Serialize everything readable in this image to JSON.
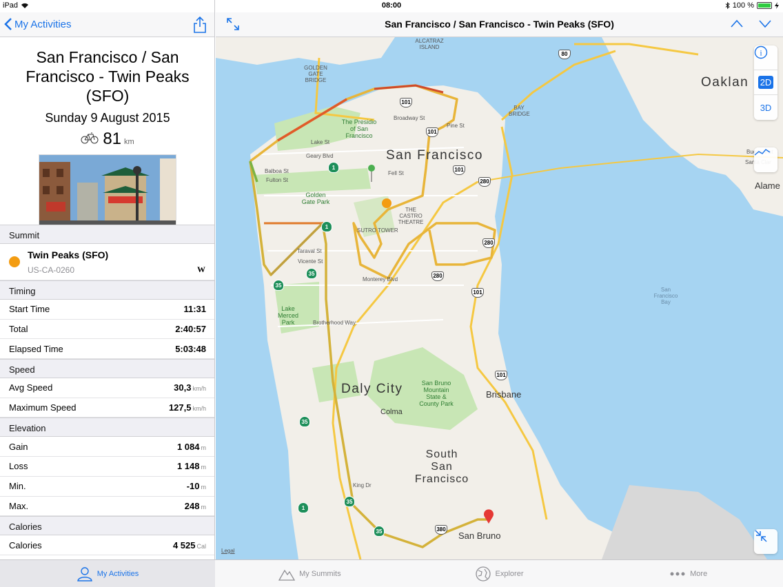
{
  "status_bar": {
    "device": "iPad",
    "time": "08:00",
    "battery": "100 %"
  },
  "left_nav": {
    "back_label": "My Activities"
  },
  "activity": {
    "title": "San Francisco / San Francisco - Twin Peaks (SFO)",
    "date": "Sunday 9 August 2015",
    "distance": "81",
    "distance_unit": "km"
  },
  "sections": {
    "summit": {
      "header": "Summit",
      "name": "Twin Peaks (SFO)",
      "code": "US-CA-0260",
      "wiki": "W"
    },
    "timing": {
      "header": "Timing",
      "rows": [
        {
          "label": "Start Time",
          "value": "11:31",
          "unit": ""
        },
        {
          "label": "Total",
          "value": "2:40:57",
          "unit": ""
        },
        {
          "label": "Elapsed Time",
          "value": "5:03:48",
          "unit": ""
        }
      ]
    },
    "speed": {
      "header": "Speed",
      "rows": [
        {
          "label": "Avg Speed",
          "value": "30,3",
          "unit": "km/h"
        },
        {
          "label": "Maximum Speed",
          "value": "127,5",
          "unit": "km/h"
        }
      ]
    },
    "elevation": {
      "header": "Elevation",
      "rows": [
        {
          "label": "Gain",
          "value": "1 084",
          "unit": "m"
        },
        {
          "label": "Loss",
          "value": "1 148",
          "unit": "m"
        },
        {
          "label": "Min.",
          "value": "-10",
          "unit": "m"
        },
        {
          "label": "Max.",
          "value": "248",
          "unit": "m"
        }
      ]
    },
    "calories": {
      "header": "Calories",
      "rows": [
        {
          "label": "Calories",
          "value": "4 525",
          "unit": "Cal"
        }
      ]
    }
  },
  "map_nav": {
    "title": "San Francisco / San Francisco - Twin Peaks (SFO)"
  },
  "map": {
    "labels": {
      "sf": "San Francisco",
      "daly": "Daly City",
      "ssf": "South San Francisco",
      "brisbane": "Brisbane",
      "colma": "Colma",
      "sanbruno": "San Bruno",
      "oakland": "Oaklan",
      "alameda": "Alame",
      "presidio": "The Presidio of San Francisco",
      "ggpark": "Golden Gate Park",
      "lakemerced": "Lake Merced Park",
      "sanbrunopark": "San Bruno Mountain State & County Park",
      "sutro": "SUTRO TOWER",
      "castro": "THE CASTRO THEATRE",
      "ggbridge": "GOLDEN GATE BRIDGE",
      "baybridge": "BAY BRIDGE",
      "alcatraz": "ALCATRAZ ISLAND",
      "sfbay": "San Francisco Bay",
      "lake_st": "Lake St",
      "geary": "Geary Blvd",
      "balboa": "Balboa St",
      "fulton": "Fulton St",
      "fell": "Fell St",
      "broadway": "Broadway St",
      "pine": "Pine St",
      "taraval": "Taraval St",
      "vicente": "Vicente St",
      "monterey": "Monterey Blvd",
      "brotherhood": "Brotherhood Way",
      "king": "King Dr",
      "buenavista": "Buena Vist",
      "santaclara": "Santa Clar"
    },
    "shields": [
      "80",
      "101",
      "101",
      "101",
      "280",
      "280",
      "280",
      "101",
      "101",
      "1",
      "1",
      "35",
      "35",
      "35",
      "35",
      "35",
      "1",
      "380"
    ],
    "controls": {
      "info": "i",
      "mode2d": "2D",
      "mode3d": "3D"
    },
    "legal": "Legal"
  },
  "tabs": [
    {
      "label": "My Activities",
      "icon": "person-icon"
    },
    {
      "label": "My Summits",
      "icon": "mountain-icon"
    },
    {
      "label": "Explorer",
      "icon": "globe-icon"
    },
    {
      "label": "More",
      "icon": "more-icon"
    }
  ],
  "colors": {
    "accent": "#1a73e8",
    "summit": "#f39c12",
    "water": "#a6d4f2",
    "land": "#f2efe9",
    "park": "#c8e6b5"
  }
}
